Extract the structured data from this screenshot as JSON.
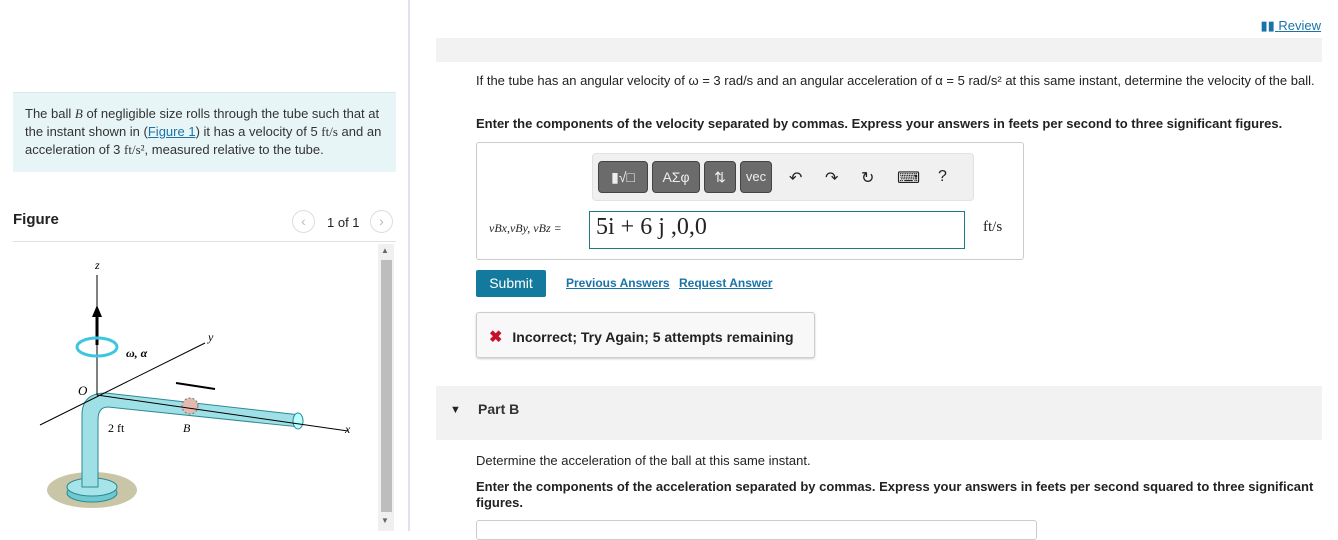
{
  "left": {
    "problem": {
      "pre": "The ball ",
      "ball": "B",
      "mid1": " of negligible size rolls through the tube such that at the instant shown in (",
      "figure_link": "Figure 1",
      "mid2": ") it has a velocity of 5 ",
      "v_unit": "ft/s",
      "mid3": " and an acceleration of 3 ",
      "a_unit": "ft/s²",
      "post": ", measured relative to the tube."
    },
    "figure_title": "Figure",
    "figure_count": "1 of 1",
    "figure_labels": {
      "z": "z",
      "y": "y",
      "x": "x",
      "o": "O",
      "omega": "ω, α",
      "dist": "2 ft",
      "b": "B"
    }
  },
  "right": {
    "review": "Review",
    "question": "If the tube has an angular velocity of ω = 3 rad/s and an angular acceleration of α = 5 rad/s² at this same instant, determine the velocity of the ball.",
    "instructions": "Enter the components of the velocity separated by commas. Express your answers in feets per second to three significant figures.",
    "toolbar": {
      "templates": "▮√□",
      "greek": "ΑΣφ",
      "arrows": "⇅",
      "vec": "vec",
      "undo": "↶",
      "redo": "↷",
      "reset": "↻",
      "keyboard": "⌨",
      "help": "?"
    },
    "answer_label": "vBx,vBy, vBz =",
    "answer_value": "5i + 6 j ,0,0",
    "answer_unit": "ft/s",
    "submit": "Submit",
    "previous_answers": "Previous Answers",
    "request_answer": "Request Answer",
    "feedback": "Incorrect; Try Again; 5 attempts remaining",
    "part_b": {
      "title": "Part B",
      "question": "Determine the acceleration of the ball at this same instant.",
      "instructions": "Enter the components of the acceleration separated by commas. Express your answers in feets per second squared to three significant figures."
    }
  }
}
